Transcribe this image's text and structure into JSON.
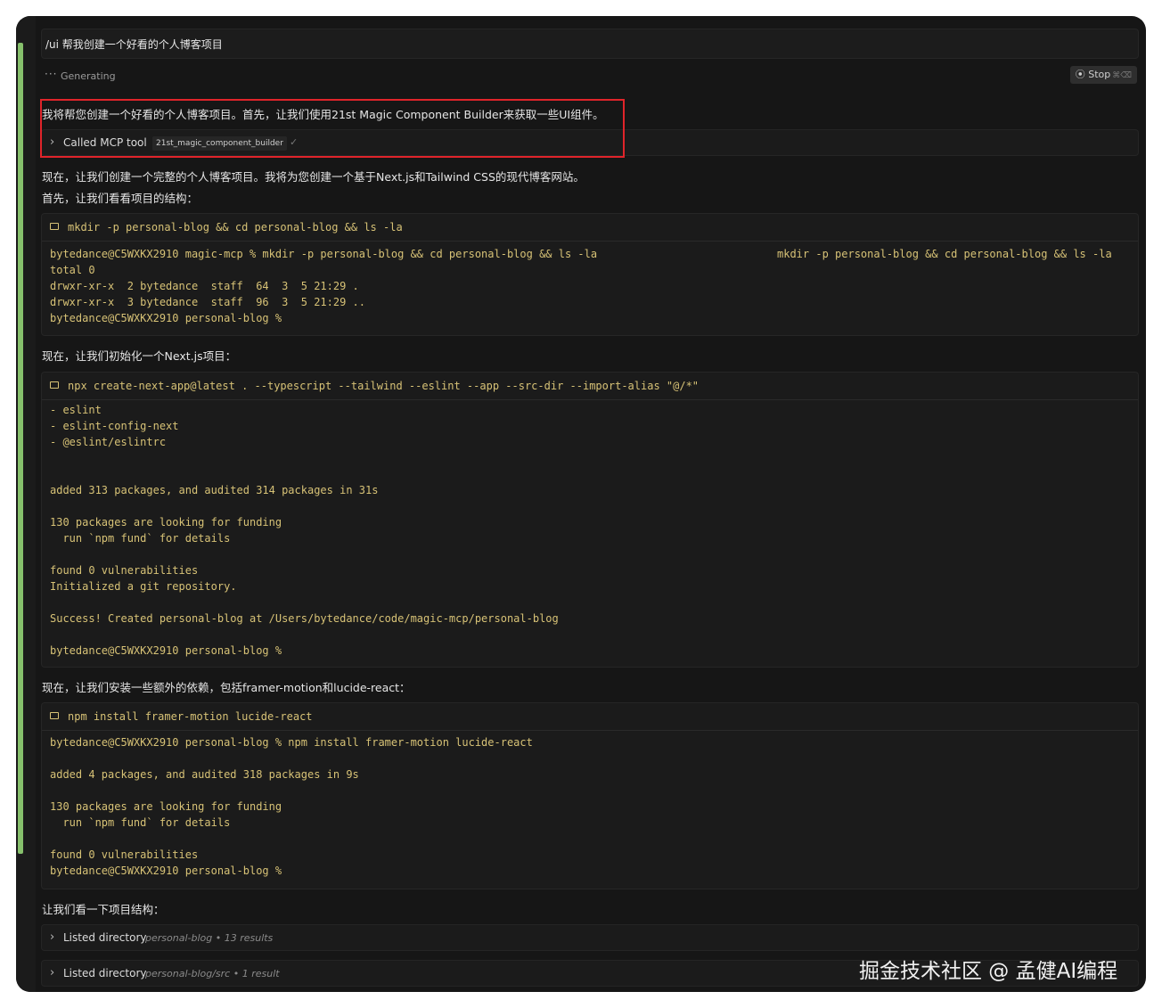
{
  "prompt": "/ui 帮我创建一个好看的个人博客项目",
  "status": {
    "label": "Generating",
    "stop_label": "Stop",
    "stop_shortcut": "⌘⌫"
  },
  "messages": {
    "intro": "我将帮您创建一个好看的个人博客项目。首先，让我们使用21st Magic Component Builder来获取一些UI组件。",
    "plan": "现在，让我们创建一个完整的个人博客项目。我将为您创建一个基于Next.js和Tailwind CSS的现代博客网站。",
    "structure": "首先，让我们看看项目的结构：",
    "init": "现在，让我们初始化一个Next.js项目：",
    "deps": "现在，让我们安装一些额外的依赖，包括framer-motion和lucide-react：",
    "look": "让我们看一下项目结构："
  },
  "mcp_tool": {
    "label": "Called MCP tool",
    "name": "21st_magic_component_builder",
    "check": "✓"
  },
  "terminal1": {
    "command": "mkdir -p personal-blog && cd personal-blog && ls -la",
    "lines": [
      "bytedance@C5WXKX2910 magic-mcp % mkdir -p personal-blog && cd personal-blog && ls -la",
      "total 0",
      "drwxr-xr-x  2 bytedance  staff  64  3  5 21:29 .",
      "drwxr-xr-x  3 bytedance  staff  96  3  5 21:29 ..",
      "bytedance@C5WXKX2910 personal-blog %"
    ],
    "echo": "mkdir -p personal-blog && cd personal-blog && ls -la"
  },
  "terminal2": {
    "command": "npx create-next-app@latest . --typescript --tailwind --eslint --app --src-dir --import-alias \"@/*\"",
    "lines": [
      "- eslint",
      "- eslint-config-next",
      "- @eslint/eslintrc",
      "added 313 packages, and audited 314 packages in 31s",
      "130 packages are looking for funding",
      "  run `npm fund` for details",
      "found 0 vulnerabilities",
      "Initialized a git repository.",
      "Success! Created personal-blog at /Users/bytedance/code/magic-mcp/personal-blog",
      "bytedance@C5WXKX2910 personal-blog %"
    ]
  },
  "terminal3": {
    "command": "npm install framer-motion lucide-react",
    "lines": [
      "bytedance@C5WXKX2910 personal-blog % npm install framer-motion lucide-react",
      "added 4 packages, and audited 318 packages in 9s",
      "130 packages are looking for funding",
      "  run `npm fund` for details",
      "found 0 vulnerabilities",
      "bytedance@C5WXKX2910 personal-blog %"
    ]
  },
  "listings": [
    {
      "label": "Listed directory",
      "meta": "personal-blog • 13 results"
    },
    {
      "label": "Listed directory",
      "meta": "personal-blog/src • 1 result"
    }
  ],
  "watermark": "掘金技术社区 @ 孟健AI编程",
  "colors": {
    "terminal_text": "#d7c276",
    "highlight": "#e0242a",
    "gutter_bar": "#86c06c"
  }
}
